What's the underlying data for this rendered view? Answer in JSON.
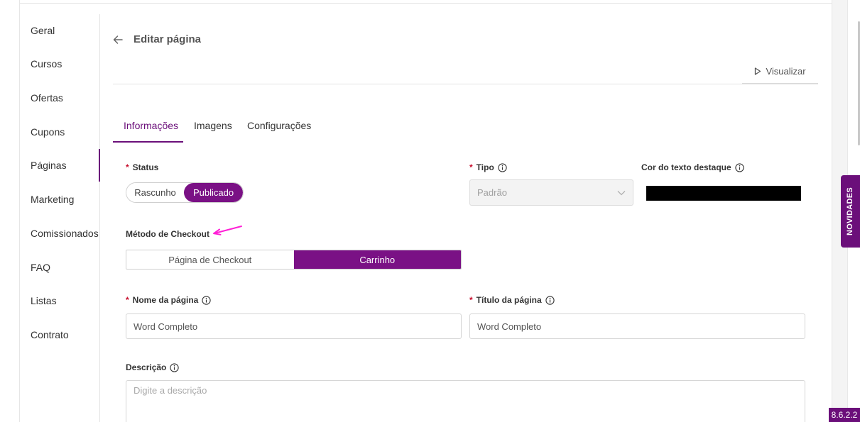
{
  "sidebar": {
    "items": [
      {
        "label": "Geral"
      },
      {
        "label": "Cursos"
      },
      {
        "label": "Ofertas"
      },
      {
        "label": "Cupons"
      },
      {
        "label": "Páginas"
      },
      {
        "label": "Marketing"
      },
      {
        "label": "Comissionados"
      },
      {
        "label": "FAQ"
      },
      {
        "label": "Listas"
      },
      {
        "label": "Contrato"
      }
    ],
    "active": "Páginas"
  },
  "header": {
    "title": "Editar página",
    "preview_label": "Visualizar"
  },
  "tabs": [
    {
      "label": "Informações",
      "active": true
    },
    {
      "label": "Imagens",
      "active": false
    },
    {
      "label": "Configurações",
      "active": false
    }
  ],
  "form": {
    "status": {
      "label": "Status",
      "options": [
        "Rascunho",
        "Publicado"
      ],
      "selected": "Publicado"
    },
    "tipo": {
      "label": "Tipo",
      "value": "Padrão"
    },
    "highlight_color": {
      "label": "Cor do texto destaque",
      "value": "#000000"
    },
    "checkout_method": {
      "label": "Método de Checkout",
      "options": [
        "Página de Checkout",
        "Carrinho"
      ],
      "selected": "Carrinho"
    },
    "page_name": {
      "label": "Nome da página",
      "value": "Word Completo"
    },
    "page_title": {
      "label": "Título da página",
      "value": "Word Completo"
    },
    "description": {
      "label": "Descrição",
      "placeholder": "Digite a descrição"
    }
  },
  "novidades_label": "NOVIDADES",
  "version": "8.6.2.2",
  "colors": {
    "accent": "#7a1185",
    "required": "#c8102e",
    "annotation_arrow": "#ff1fd6"
  }
}
